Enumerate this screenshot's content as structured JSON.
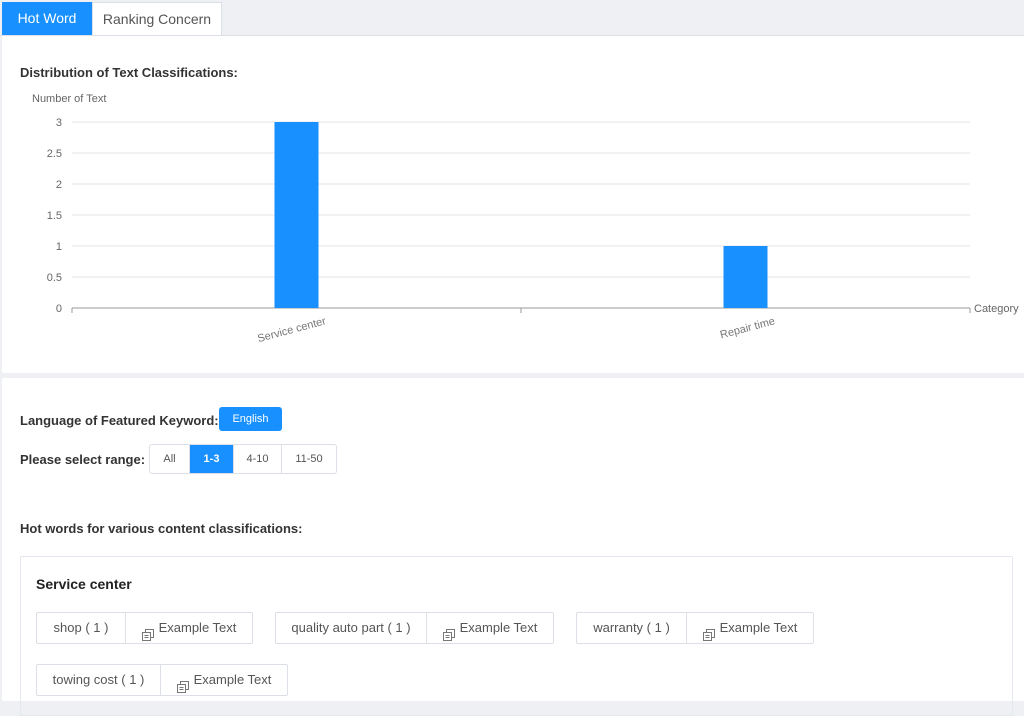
{
  "tabs": [
    {
      "label": "Hot Word",
      "active": true
    },
    {
      "label": "Ranking Concern",
      "active": false
    }
  ],
  "chart_section": {
    "title": "Distribution of Text Classifications:"
  },
  "chart_data": {
    "type": "bar",
    "categories": [
      "Service center",
      "Repair time"
    ],
    "values": [
      3,
      1
    ],
    "xlabel": "Category",
    "ylabel": "Number of Text",
    "ylim": [
      0,
      3
    ],
    "yticks": [
      "0",
      "0.5",
      "1",
      "1.5",
      "2",
      "2.5",
      "3"
    ],
    "grid": true,
    "bar_color": "#1890ff"
  },
  "language": {
    "label": "Language of Featured Keyword:",
    "value": "English"
  },
  "range": {
    "label": "Please select range:",
    "options": [
      "All",
      "1-3",
      "4-10",
      "11-50"
    ],
    "selected": "1-3"
  },
  "hotwords": {
    "title": "Hot words for various content classifications:",
    "groups": [
      {
        "name": "Service center",
        "example_label": "Example Text",
        "chips": [
          "shop ( 1 )",
          "quality auto part ( 1 )",
          "warranty ( 1 )",
          "towing cost ( 1 )"
        ]
      }
    ]
  },
  "colors": {
    "accent": "#1890ff",
    "background": "#eef0f3",
    "panel": "#ffffff"
  }
}
